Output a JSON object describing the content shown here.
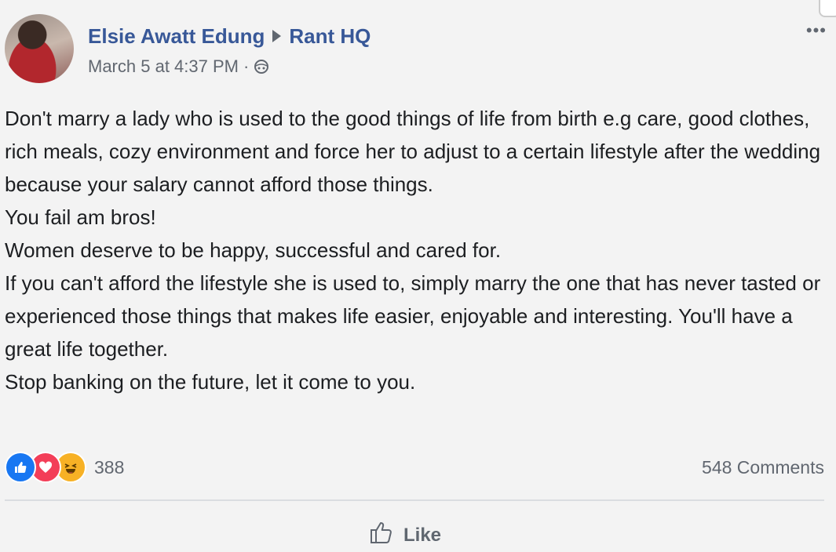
{
  "post": {
    "author": "Elsie Awatt Edung",
    "group": "Rant HQ",
    "timestamp": "March 5 at 4:37 PM",
    "separator": "·",
    "more_label": "•••",
    "paragraphs": [
      "Don't marry a lady who is used to the good things of life from birth e.g care, good clothes, rich meals, cozy environment and force her to adjust to a certain lifestyle after the wedding because your salary cannot afford those things.",
      "You fail am bros!",
      "Women deserve to be happy, successful and cared for.",
      "If you can't afford the lifestyle she is used to, simply marry the one that has never tasted or experienced those things that makes life easier, enjoyable and interesting. You'll have a great life together.",
      "Stop banking on the future, let it come to you."
    ]
  },
  "stats": {
    "reaction_count": "388",
    "comments": "548 Comments",
    "reaction_icons": [
      "like-icon",
      "love-icon",
      "haha-icon"
    ]
  },
  "actions": {
    "like_label": "Like"
  },
  "colors": {
    "name_blue": "#385898",
    "text": "#1c1e21",
    "meta": "#616770",
    "like_blue": "#1877f2",
    "love_red": "#f33e58",
    "haha_yellow": "#f7b125"
  }
}
